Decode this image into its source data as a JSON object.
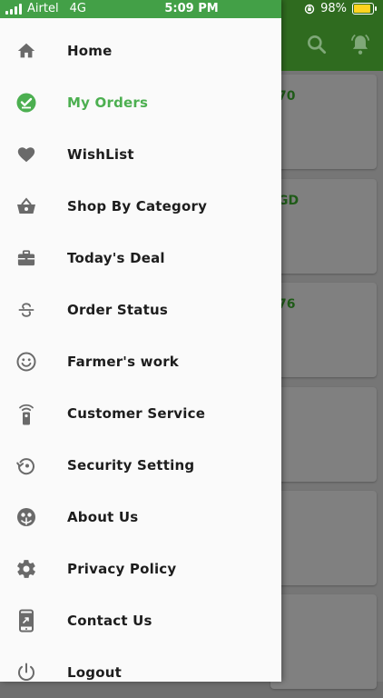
{
  "statusbar": {
    "carrier": "Airtel",
    "network": "4G",
    "time": "5:09 PM",
    "battery": "98%",
    "battery_level": 0.98,
    "signal_bars": 4
  },
  "colors": {
    "accent": "#4caf50",
    "header_green": "#43a047",
    "text": "#1d1d1d",
    "icon_gray": "#6a6a6a"
  },
  "background_cards": [
    "70",
    "GD",
    "76",
    "",
    "",
    ""
  ],
  "menu": {
    "items": [
      {
        "label": "Home",
        "icon": "home-icon",
        "active": false
      },
      {
        "label": "My Orders",
        "icon": "check-circle-icon",
        "active": true
      },
      {
        "label": "WishList",
        "icon": "heart-icon",
        "active": false
      },
      {
        "label": "Shop By Category",
        "icon": "basket-icon",
        "active": false
      },
      {
        "label": "Today's Deal",
        "icon": "briefcase-icon",
        "active": false
      },
      {
        "label": "Order Status",
        "icon": "strikethrough-s-icon",
        "active": false
      },
      {
        "label": "Farmer's work",
        "icon": "smiley-icon",
        "active": false
      },
      {
        "label": "Customer Service",
        "icon": "remote-signal-icon",
        "active": false
      },
      {
        "label": "Security Setting",
        "icon": "restore-icon",
        "active": false
      },
      {
        "label": "About Us",
        "icon": "face-icon",
        "active": false
      },
      {
        "label": "Privacy Policy",
        "icon": "gear-icon",
        "active": false
      },
      {
        "label": "Contact Us",
        "icon": "phone-forward-icon",
        "active": false
      },
      {
        "label": "Logout",
        "icon": "power-icon",
        "active": false
      }
    ]
  }
}
